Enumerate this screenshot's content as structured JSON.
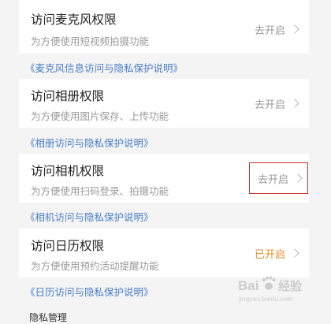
{
  "permissions": [
    {
      "title": "访问麦克风权限",
      "desc": "为方便使用短视频拍摄功能",
      "status": "去开启",
      "link": "《麦克风信息访问与隐私保护说明》"
    },
    {
      "title": "访问相册权限",
      "desc": "为方便使用图片保存、上传功能",
      "status": "去开启",
      "link": "《相册访问与隐私保护说明》"
    },
    {
      "title": "访问相机权限",
      "desc": "为方便使用扫码登录、拍摄功能",
      "status": "去开启",
      "link": "《相机访问与隐私保护说明》"
    },
    {
      "title": "访问日历权限",
      "desc": "为方便使用预约活动提醒功能",
      "status": "已开启",
      "link": "《日历访问与隐私保护说明》"
    }
  ],
  "next_section_title": "隐私管理",
  "watermark": {
    "brand": "Bai",
    "brand2": "经验",
    "sub": "jingyan.baidu.com"
  },
  "colors": {
    "status_off": "#9a9a9a",
    "status_on": "#e08e2e",
    "link": "#4a7ec6",
    "highlight_box": "#d22c2c"
  }
}
